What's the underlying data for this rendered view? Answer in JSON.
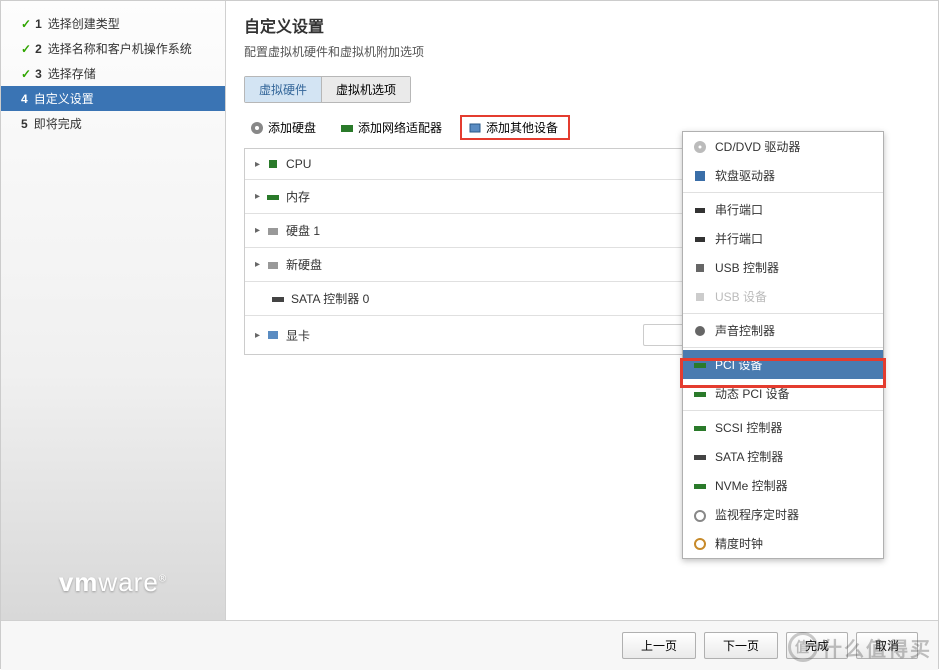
{
  "sidebar": {
    "steps": [
      {
        "num": "1",
        "label": "选择创建类型",
        "state": "done"
      },
      {
        "num": "2",
        "label": "选择名称和客户机操作系统",
        "state": "done"
      },
      {
        "num": "3",
        "label": "选择存储",
        "state": "done"
      },
      {
        "num": "4",
        "label": "自定义设置",
        "state": "active"
      },
      {
        "num": "5",
        "label": "即将完成",
        "state": "pending"
      }
    ],
    "logo": "vmware"
  },
  "main": {
    "title": "自定义设置",
    "subtitle": "配置虚拟机硬件和虚拟机附加选项",
    "tabs": [
      {
        "label": "虚拟硬件",
        "active": true
      },
      {
        "label": "虚拟机选项",
        "active": false
      }
    ],
    "toolbar": {
      "add_disk": "添加硬盘",
      "add_nic": "添加网络适配器",
      "add_other": "添加其他设备"
    },
    "hardware": [
      {
        "icon": "cpu",
        "label": "CPU",
        "expandable": true
      },
      {
        "icon": "mem",
        "label": "内存",
        "expandable": true
      },
      {
        "icon": "hdd",
        "label": "硬盘 1",
        "expandable": true,
        "removable": true
      },
      {
        "icon": "hdd",
        "label": "新硬盘",
        "expandable": true,
        "removable": true
      },
      {
        "icon": "sata",
        "label": "SATA 控制器 0",
        "expandable": false,
        "indent": true,
        "removable": true
      },
      {
        "icon": "vga",
        "label": "显卡",
        "expandable": true,
        "dropdown": true
      }
    ]
  },
  "menu": {
    "items": [
      {
        "icon": "cd",
        "label": "CD/DVD 驱动器"
      },
      {
        "icon": "floppy",
        "label": "软盘驱动器"
      },
      {
        "sep": true
      },
      {
        "icon": "serial",
        "label": "串行端口"
      },
      {
        "icon": "parallel",
        "label": "并行端口"
      },
      {
        "icon": "usb",
        "label": "USB 控制器"
      },
      {
        "icon": "usb",
        "label": "USB 设备",
        "disabled": true
      },
      {
        "sep": true
      },
      {
        "icon": "sound",
        "label": "声音控制器"
      },
      {
        "sep": true
      },
      {
        "icon": "pci",
        "label": "PCI 设备",
        "selected": true
      },
      {
        "icon": "pci",
        "label": "动态 PCI 设备"
      },
      {
        "sep": true
      },
      {
        "icon": "scsi",
        "label": "SCSI 控制器"
      },
      {
        "icon": "sata",
        "label": "SATA 控制器"
      },
      {
        "icon": "nvme",
        "label": "NVMe 控制器"
      },
      {
        "icon": "timer",
        "label": "监视程序定时器"
      },
      {
        "icon": "clock",
        "label": "精度时钟"
      }
    ]
  },
  "footer": {
    "prev": "上一页",
    "next": "下一页",
    "finish": "完成",
    "cancel": "取消"
  },
  "watermark": "什么值得买"
}
